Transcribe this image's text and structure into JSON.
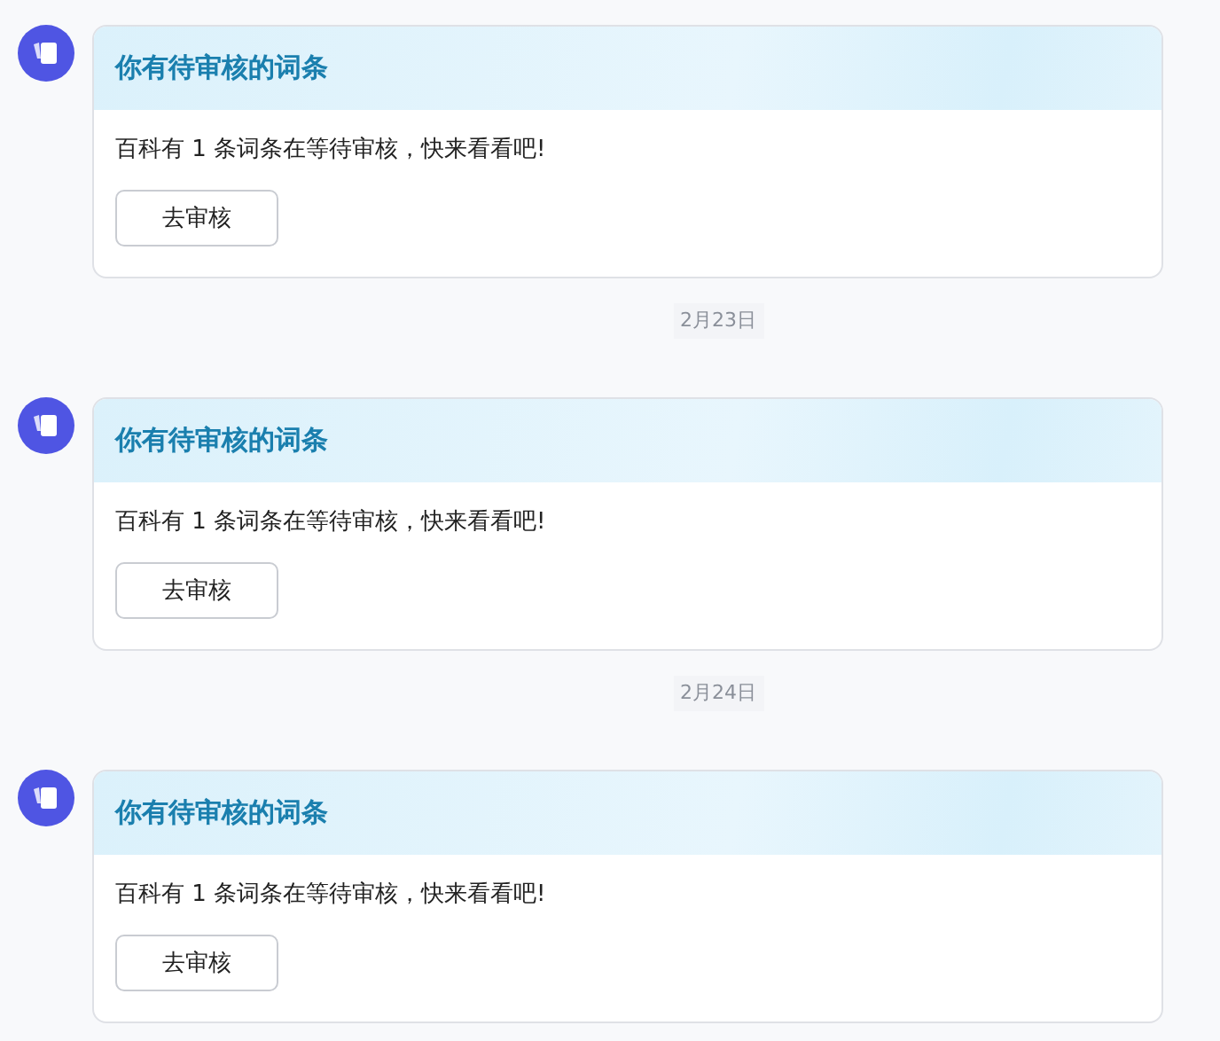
{
  "feed": [
    {
      "kind": "message",
      "title": "你有待审核的词条",
      "body": "百科有 1 条词条在等待审核，快来看看吧!",
      "button": "去审核"
    },
    {
      "kind": "date",
      "text": "2月23日"
    },
    {
      "kind": "message",
      "title": "你有待审核的词条",
      "body": "百科有 1 条词条在等待审核，快来看看吧!",
      "button": "去审核"
    },
    {
      "kind": "date",
      "text": "2月24日"
    },
    {
      "kind": "message",
      "title": "你有待审核的词条",
      "body": "百科有 1 条词条在等待审核，快来看看吧!",
      "button": "去审核"
    }
  ]
}
